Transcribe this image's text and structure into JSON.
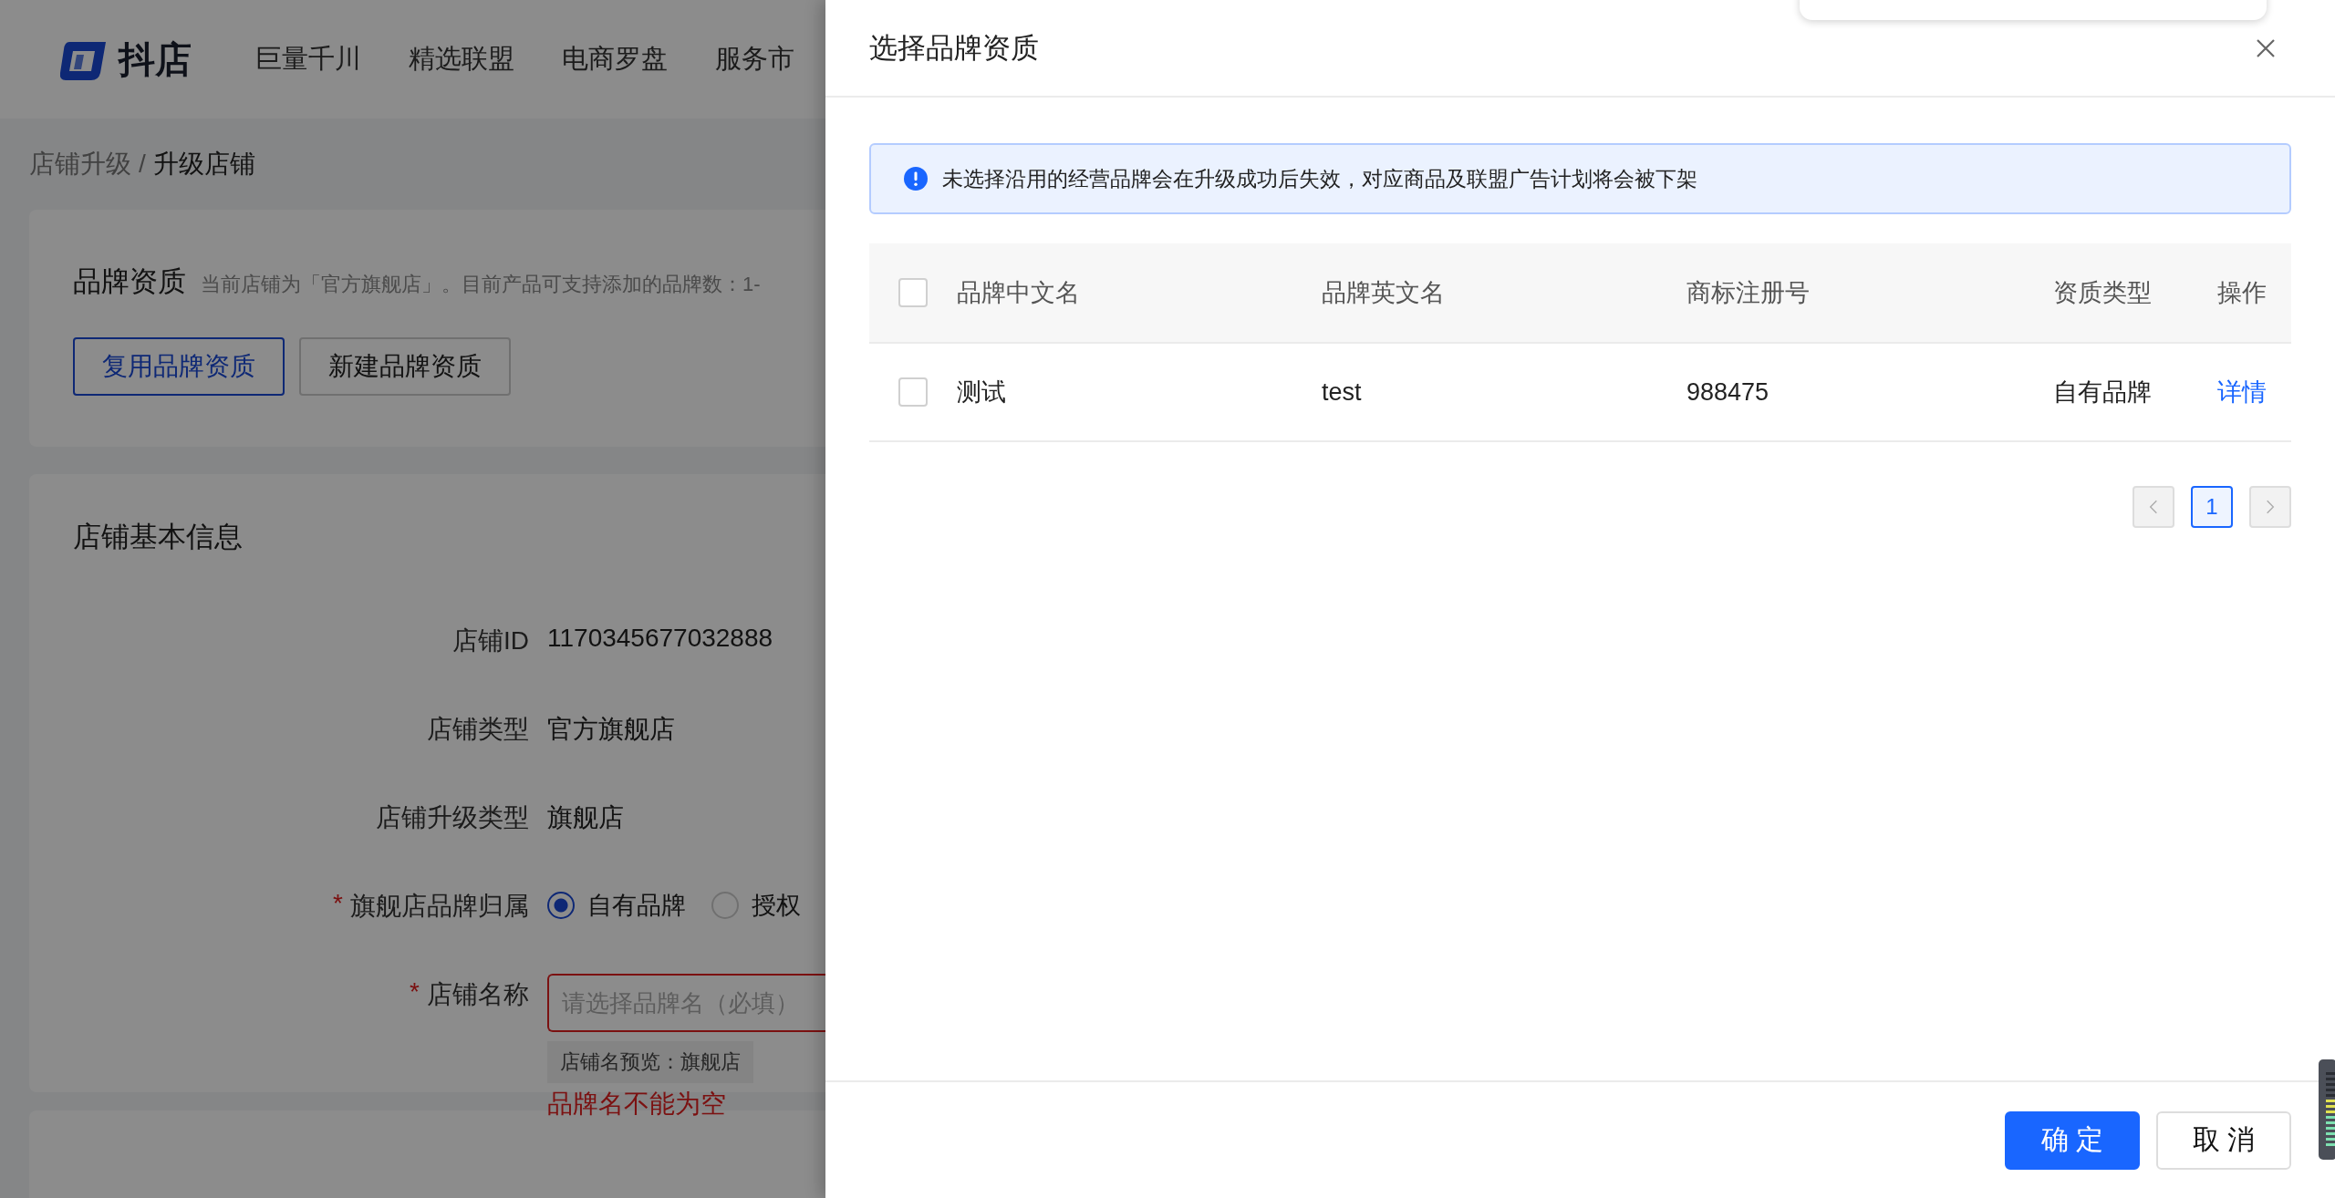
{
  "top_nav": {
    "logo_text": "抖店",
    "items": [
      "巨量千川",
      "精选联盟",
      "电商罗盘",
      "服务市"
    ]
  },
  "breadcrumb": {
    "separator": "/",
    "items": [
      {
        "label": "店铺升级",
        "current": false
      },
      {
        "label": "升级店铺",
        "current": true
      }
    ]
  },
  "brand_section": {
    "title": "品牌资质",
    "description": "当前店铺为「官方旗舰店」。目前产品可支持添加的品牌数：1-",
    "buttons": [
      {
        "label": "复用品牌资质",
        "primary": true
      },
      {
        "label": "新建品牌资质",
        "primary": false
      }
    ]
  },
  "basic_info": {
    "title": "店铺基本信息",
    "fields": [
      {
        "kind": "text",
        "label": "店铺ID",
        "value": "1170345677032888"
      },
      {
        "kind": "text",
        "label": "店铺类型",
        "value": "官方旗舰店"
      },
      {
        "kind": "text",
        "label": "店铺升级类型",
        "value": "旗舰店"
      },
      {
        "kind": "radio",
        "label": "旗舰店品牌归属",
        "required_mark": "*",
        "options": [
          {
            "label": "自有品牌",
            "selected": true
          },
          {
            "label": "授权",
            "selected": false
          }
        ]
      },
      {
        "kind": "input",
        "label": "店铺名称",
        "required_mark": "*",
        "placeholder": "请选择品牌名（必填）",
        "hint": "店铺名预览：旗舰店",
        "error": "品牌名不能为空"
      }
    ]
  },
  "drawer": {
    "title": "选择品牌资质",
    "alert": "未选择沿用的经营品牌会在升级成功后失效，对应商品及联盟广告计划将会被下架",
    "table": {
      "header_checked": false,
      "columns": [
        "品牌中文名",
        "品牌英文名",
        "商标注册号",
        "资质类型",
        "操作"
      ],
      "rows": [
        {
          "checked": false,
          "cells": [
            "测试",
            "test",
            "988475",
            "自有品牌"
          ],
          "action": "详情"
        }
      ]
    },
    "pagination": {
      "prev_disabled": true,
      "next_disabled": true,
      "pages": [
        {
          "label": "1",
          "selected": true
        }
      ]
    },
    "buttons": [
      {
        "label": "确 定",
        "primary": true
      },
      {
        "label": "取 消",
        "primary": false
      }
    ]
  }
}
